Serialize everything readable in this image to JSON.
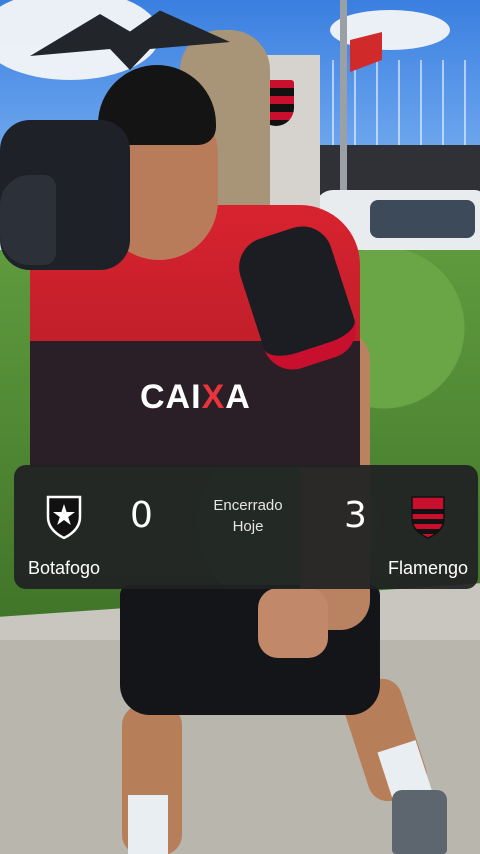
{
  "scoreboard": {
    "home_team": {
      "name": "Botafogo",
      "score": "0",
      "crest_icon": "botafogo-crest-icon"
    },
    "away_team": {
      "name": "Flamengo",
      "score": "3",
      "crest_icon": "flamengo-crest-icon"
    },
    "status": "Encerrado",
    "date": "Hoje"
  },
  "jersey": {
    "sponsor_prefix": "CAI",
    "sponsor_x": "X",
    "sponsor_suffix": "A"
  },
  "colors": {
    "overlay_bg": "#202123",
    "flamengo_red": "#c8102e",
    "text": "#ffffff"
  }
}
